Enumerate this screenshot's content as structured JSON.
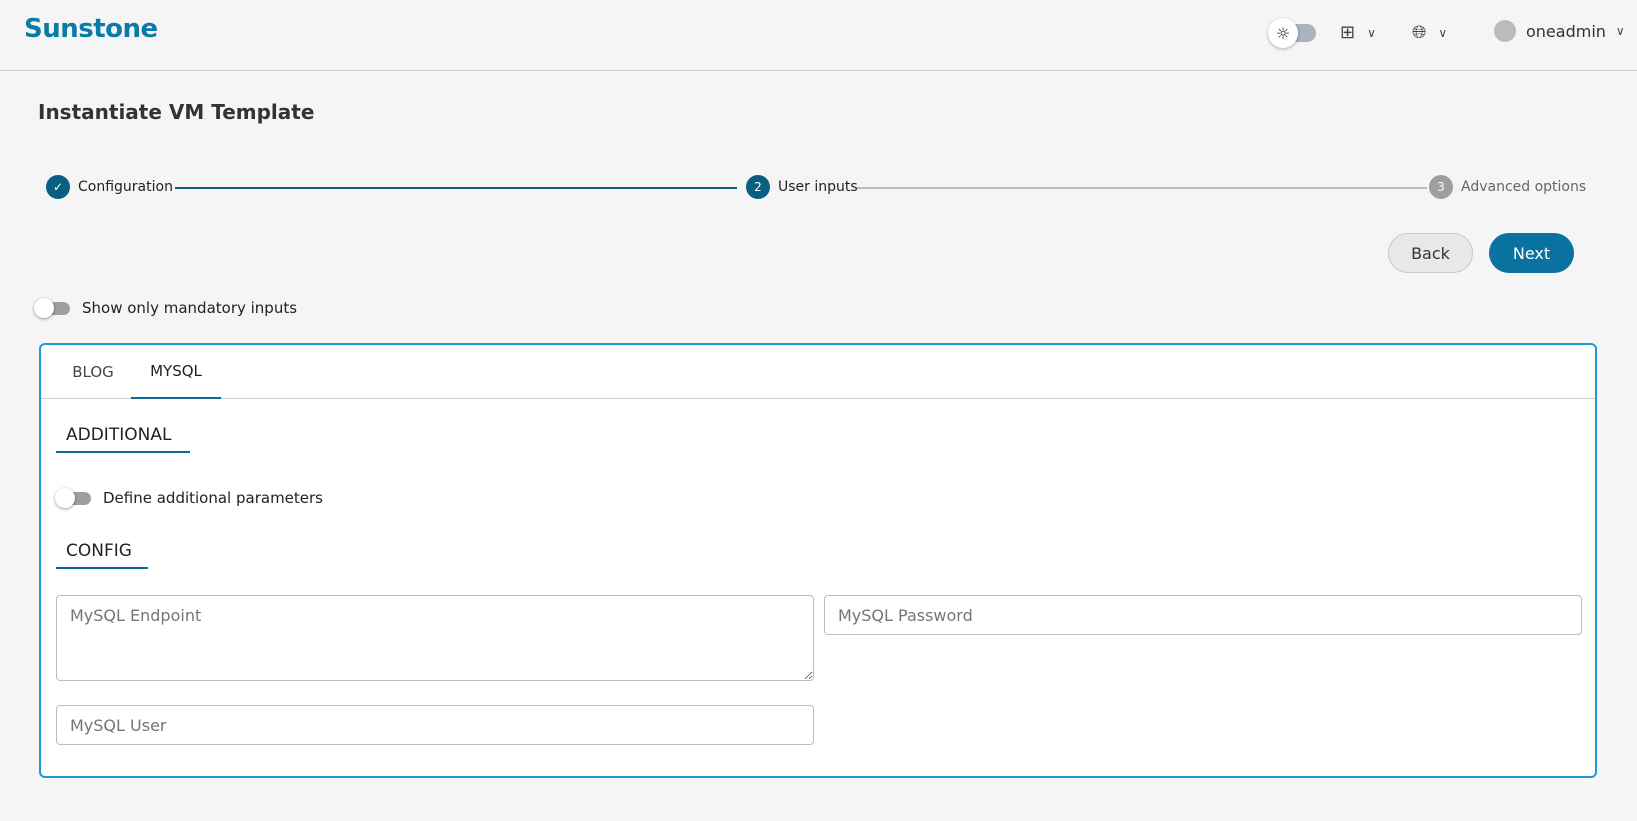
{
  "header": {
    "logo": "Sunstone",
    "theme_icon": "sun-icon",
    "apps_icon": "grid-icon",
    "language_icon": "globe-icon",
    "user": "oneadmin"
  },
  "page": {
    "title": "Instantiate VM Template"
  },
  "stepper": {
    "steps": [
      {
        "label": "Configuration",
        "number": "1",
        "state": "completed"
      },
      {
        "label": "User inputs",
        "number": "2",
        "state": "active"
      },
      {
        "label": "Advanced options",
        "number": "3",
        "state": "pending"
      }
    ]
  },
  "actions": {
    "back": "Back",
    "next": "Next"
  },
  "mandatory_toggle": {
    "label": "Show only mandatory inputs",
    "on": false
  },
  "tabs": [
    {
      "label": "BLOG",
      "active": false
    },
    {
      "label": "MYSQL",
      "active": true
    }
  ],
  "sections": {
    "additional": "ADDITIONAL",
    "config": "CONFIG"
  },
  "additional_toggle": {
    "label": "Define additional parameters",
    "on": false
  },
  "fields": {
    "endpoint": {
      "placeholder": "MySQL Endpoint",
      "value": ""
    },
    "password": {
      "placeholder": "MySQL Password",
      "value": ""
    },
    "user": {
      "placeholder": "MySQL User",
      "value": ""
    }
  },
  "colors": {
    "primary": "#0a5f80",
    "button": "#0a72a0",
    "card_border": "#1d9ad6"
  }
}
